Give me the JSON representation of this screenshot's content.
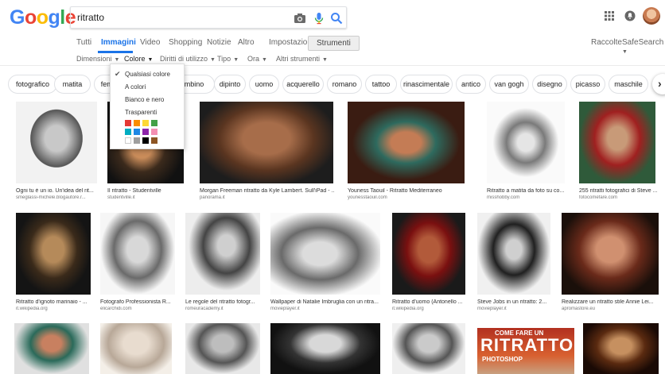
{
  "logo": [
    "G",
    "o",
    "o",
    "g",
    "l",
    "e"
  ],
  "search": {
    "query": "ritratto"
  },
  "tabs": [
    {
      "label": "Tutti"
    },
    {
      "label": "Immagini"
    },
    {
      "label": "Video"
    },
    {
      "label": "Shopping"
    },
    {
      "label": "Notizie"
    },
    {
      "label": "Altro"
    },
    {
      "label": "Impostazioni"
    },
    {
      "label": "Strumenti"
    }
  ],
  "header_right": {
    "collections": "Raccolte",
    "safesearch": "SafeSearch"
  },
  "filters": [
    {
      "label": "Dimensioni"
    },
    {
      "label": "Colore"
    },
    {
      "label": "Diritti di utilizzo"
    },
    {
      "label": "Tipo"
    },
    {
      "label": "Ora"
    },
    {
      "label": "Altri strumenti"
    }
  ],
  "chips": [
    "fotografico",
    "matita",
    "femm",
    "bambino",
    "dipinto",
    "uomo",
    "acquerello",
    "romano",
    "tattoo",
    "rinascimentale",
    "antico",
    "van gogh",
    "disegno",
    "picasso",
    "maschile"
  ],
  "color_menu": {
    "items": [
      "Qualsiasi colore",
      "A colori",
      "Bianco e nero",
      "Trasparenti"
    ],
    "swatches": [
      "#e53935",
      "#fb8c00",
      "#fdd835",
      "#43a047",
      "#00acc1",
      "#1e88e5",
      "#8e24aa",
      "#f48fb1",
      "#ffffff",
      "#9e9e9e",
      "#000000",
      "#8d5524"
    ]
  },
  "images": [
    {
      "caption": "Ogni tu è un io. Un'idea del rit...",
      "source": "smeglassi-michele.blogautore.r..."
    },
    {
      "caption": "Il ritratto - Studentville",
      "source": "studentville.it"
    },
    {
      "caption": "Morgan Freeman ritratto da Kyle Lambert. Sull'iPad - ...",
      "source": "panorama.it"
    },
    {
      "caption": "Youness Taouil - Ritratto Mediterraneo",
      "source": "younesstaouil.com"
    },
    {
      "caption": "Ritratto a matita da foto su co...",
      "source": "misshobby.com"
    },
    {
      "caption": "255 ritratti fotografici di Steve ...",
      "source": "fotocomefare.com"
    },
    {
      "caption": "Ritratto d'ignoto marinaio - ...",
      "source": "it.wikipedia.org"
    },
    {
      "caption": "Fotografo Professionista R...",
      "source": "elicarchidi.com"
    },
    {
      "caption": "Le regole del ritratto fotogr...",
      "source": "romeuracademy.it"
    },
    {
      "caption": "Wallpaper di Natalie Imbruglia con un ritra...",
      "source": "movieplayer.it"
    },
    {
      "caption": "Ritratto d'uomo (Antonello ...",
      "source": "it.wikipedia.org"
    },
    {
      "caption": "Steve Jobs in un ritratto: 2...",
      "source": "movieplayer.it"
    },
    {
      "caption": "Realizzare un ritratto stile Annie Lei...",
      "source": "apromastore.eu"
    }
  ],
  "magazine": {
    "kicker": "COME FARE UN",
    "title": "RITRATTO",
    "subtitle": "PHOTOSHOP"
  }
}
